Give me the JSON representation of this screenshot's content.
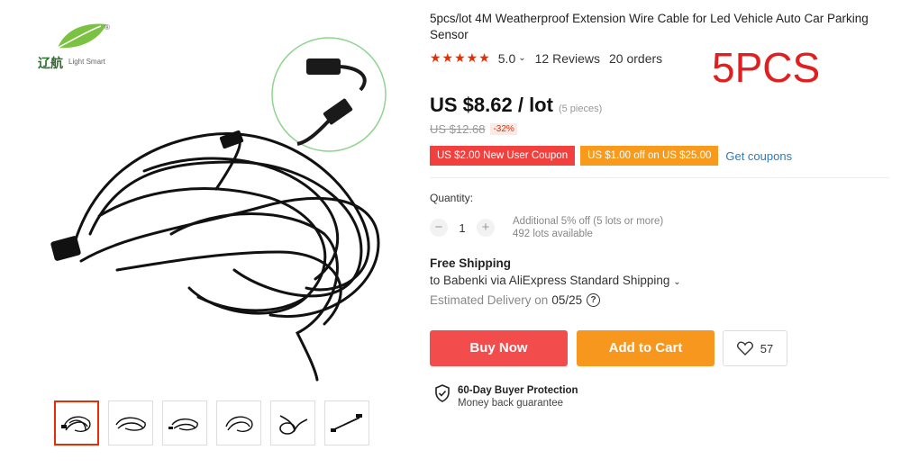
{
  "brand": {
    "name_cn": "辽航",
    "sub": "Light Smart",
    "reg": "®"
  },
  "product": {
    "title": "5pcs/lot 4M Weatherproof Extension Wire Cable for Led Vehicle Auto Car Parking Sensor",
    "rating": "5.0",
    "reviews": "12 Reviews",
    "orders": "20 orders",
    "overlay_label": "5PCS",
    "price": "US $8.62 / lot",
    "pieces": "(5 pieces)",
    "old_price": "US $12.68",
    "discount": "-32%"
  },
  "coupons": {
    "new_user": "US $2.00 New User Coupon",
    "off": "US $1.00 off on US $25.00",
    "get": "Get coupons"
  },
  "quantity": {
    "label": "Quantity:",
    "value": "1",
    "minus": "−",
    "plus": "+",
    "extra": "Additional 5% off (5 lots or more)",
    "available": "492 lots available"
  },
  "shipping": {
    "free": "Free Shipping",
    "to": "to Babenki via AliExpress Standard Shipping",
    "estimated": "Estimated Delivery on",
    "date": "05/25"
  },
  "actions": {
    "buy": "Buy Now",
    "cart": "Add to Cart",
    "wish_count": "57"
  },
  "protection": {
    "title": "60-Day Buyer Protection",
    "sub": "Money back guarantee"
  },
  "colors": {
    "accent_red": "#f24c4c",
    "accent_orange": "#f8971d",
    "star": "#e62e04",
    "link": "#2a7bbf"
  },
  "gallery": {
    "thumb_count": 6,
    "active_index": 0
  }
}
